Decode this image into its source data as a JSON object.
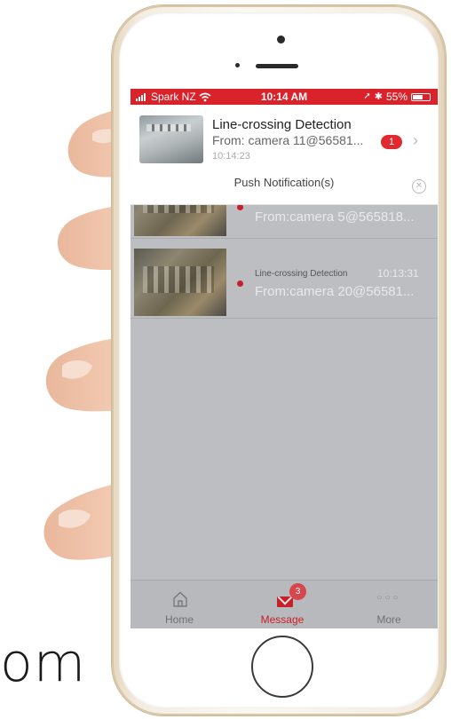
{
  "background": {
    "text": "om"
  },
  "status_bar": {
    "carrier": "Spark NZ",
    "time": "10:14 AM",
    "battery": "55%",
    "color": "#d9222a"
  },
  "notification": {
    "title": "Line-crossing Detection",
    "from": "From: camera 11@56581...",
    "time": "10:14:23",
    "badge": "1",
    "push_label": "Push Notification(s)",
    "close_icon": "close-icon",
    "chevron_icon": "chevron-right-icon"
  },
  "messages": [
    {
      "title": "",
      "time": "",
      "from": "From:camera 5@565818..."
    },
    {
      "title": "Line-crossing Detection",
      "time": "10:13:31",
      "from": "From:camera 20@56581..."
    }
  ],
  "tabbar": {
    "tabs": [
      {
        "label": "Home",
        "icon": "home-icon"
      },
      {
        "label": "Message",
        "icon": "envelope-icon",
        "badge": "3"
      },
      {
        "label": "More",
        "icon": "more-dots-icon"
      }
    ],
    "active_color": "#c8202a"
  }
}
